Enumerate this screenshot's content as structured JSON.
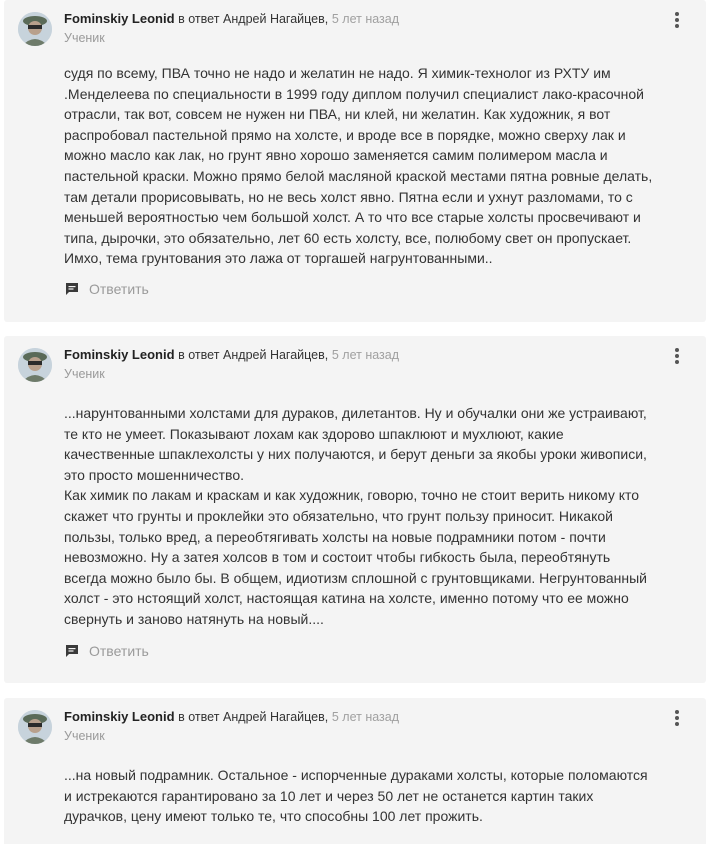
{
  "comments": [
    {
      "author": "Fominskiy Leonid",
      "reply_prefix": "в ответ",
      "reply_user": "Андрей Нагайцев",
      "comma": ",",
      "time": "5 лет назад",
      "role": "Ученик",
      "text": "судя по всему, ПВА точно не надо и желатин не надо. Я химик-технолог из РХТУ им\n.Менделеева по специальности в 1999 году диплом получил специалист лако-красочной\nотрасли, так вот, совсем не нужен ни ПВА, ни клей, ни желатин. Как художник, я вот\nраспробовал пастельной прямо на холсте, и вроде все в порядке, можно сверху лак и\nможно масло как лак, но грунт явно хорошо заменяется самим полимером масла и\nпастельной краски. Можно прямо белой масляной краской местами пятна ровные делать,\nтам детали прорисовывать, но не весь холст явно. Пятна если и ухнут разломами, то с\nменьшей вероятностью чем большой холст. А то что все старые холсты просвечивают и\nтипа, дырочки, это обязательно, лет 60 есть холсту, все, полюбому свет он пропускает.\nИмхо, тема грунтования это лажа от торгашей нагрунтованными..",
      "reply_label": "Ответить"
    },
    {
      "author": "Fominskiy Leonid",
      "reply_prefix": "в ответ",
      "reply_user": "Андрей Нагайцев",
      "comma": ",",
      "time": "5 лет назад",
      "role": "Ученик",
      "text": "...нарунтованными холстами для дураков, дилетантов. Ну и обучалки они же устраивают,\nте кто не умеет. Показывают лохам как здорово шпаклюют и мухлюют, какие\nкачественные шпаклехолсты у них получаются, и берут деньги за якобы уроки живописи,\nэто просто мошенничество.\nКак химик по лакам и краскам и как художник, говорю, точно не стоит верить никому кто\nскажет что грунты и проклейки это обязательно, что грунт пользу приносит. Никакой\nпользы, только вред, а переобтягивать холсты на новые подрамники потом - почти\nневозможно. Ну а затея холсов в том и состоит чтобы гибкость была, переобтянуть\nвсегда можно было бы. В общем, идиотизм сплошной с грунтовщиками. Негрунтованный\nхолст - это нстоящий холст, настоящая катина на холсте, именно потому что ее можно\nсвернуть и заново натянуть на новый....",
      "reply_label": "Ответить"
    },
    {
      "author": "Fominskiy Leonid",
      "reply_prefix": "в ответ",
      "reply_user": "Андрей Нагайцев",
      "comma": ",",
      "time": "5 лет назад",
      "role": "Ученик",
      "text": "...на новый подрамник. Остальное - испорченные дураками холсты, которые поломаются\nи истрекаются гарантировано за 10 лет и через 50 лет не останется картин таких\nдурачков, цену имеют только те, что способны 100 лет прожить."
    }
  ],
  "icons": {
    "more": "more-vertical-icon",
    "reply": "comment-icon",
    "avatar": "user-avatar"
  },
  "colors": {
    "card_background": "#f4f4f4",
    "muted_text": "#9a9a9a",
    "body_text": "#333333"
  }
}
